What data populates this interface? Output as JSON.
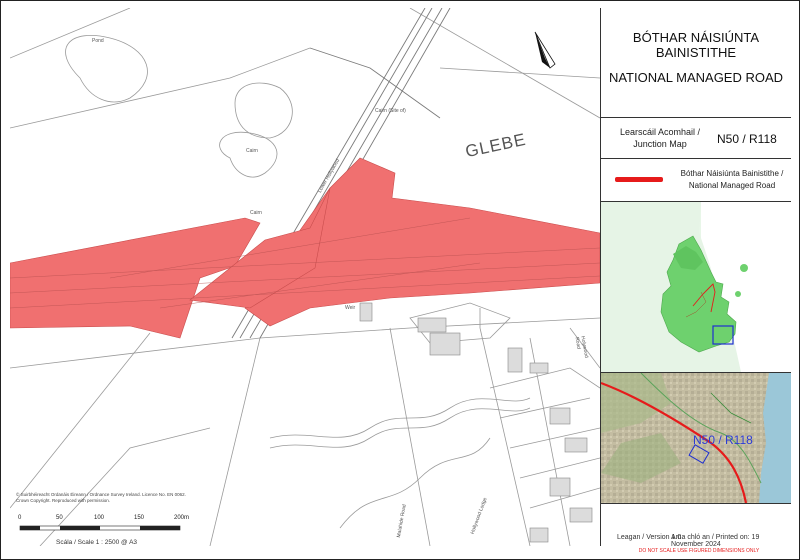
{
  "title": {
    "irish": "BÓTHAR NÁISIÚNTA BAINISTITHE",
    "english": "NATIONAL MANAGED ROAD"
  },
  "junction_map": {
    "label": "Learscáil Acomhail / Junction Map",
    "code": "N50 / R118"
  },
  "legend": {
    "label": "Bóthar Náisiúnta Bainistithe / National Managed Road",
    "color": "#e61b1b"
  },
  "locator_map": {
    "land_color": "#6ed16e",
    "background": "#e8f6e8"
  },
  "inset_photo": {
    "label": "N50 / R118",
    "label_color": "#2b3bd6"
  },
  "map": {
    "place_label": "GLEBE",
    "small_labels": [
      "Pond",
      "Cairn",
      "Cairn",
      "Cairn (Site of)",
      "Lower Hollywood",
      "Weir",
      "Holywood Road",
      "Hollywood Lodge",
      "Malahide Road"
    ],
    "managed_road_fill": "#f07070"
  },
  "scale_bar": {
    "ticks": [
      "0",
      "50",
      "100",
      "150",
      "200m"
    ],
    "caption": "Scála / Scale 1 : 2500 @ A3"
  },
  "footer": {
    "version": "Leagan / Version 1.0",
    "printed": "Ama chló an / Printed on:   19 November 2024",
    "disclaimer": "DO NOT SCALE USE FIGURED DIMENSIONS ONLY"
  },
  "credits": "© Suirbhéireacht Ordanáis Éireann / Ordnance Survey Ireland. Licence No. EN 0062. Crown Copyright. Reproduced with permission."
}
